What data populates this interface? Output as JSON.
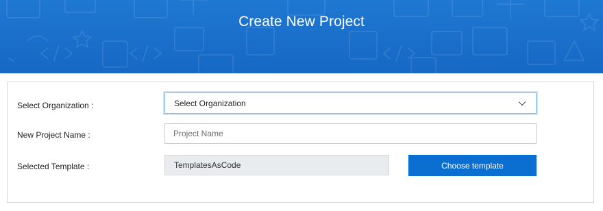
{
  "banner": {
    "title": "Create New Project",
    "background_color": "#1f78d1"
  },
  "form": {
    "organization": {
      "label": "Select Organization :",
      "selected": "Select Organization"
    },
    "project_name": {
      "label": "New Project Name :",
      "placeholder": "Project Name",
      "value": ""
    },
    "template": {
      "label": "Selected Template :",
      "value": "TemplatesAsCode",
      "button_label": "Choose template"
    }
  },
  "colors": {
    "primary_button": "#0b6fd1",
    "readonly_bg": "#e9ecef"
  },
  "icons": [
    "chevron-down-icon"
  ]
}
